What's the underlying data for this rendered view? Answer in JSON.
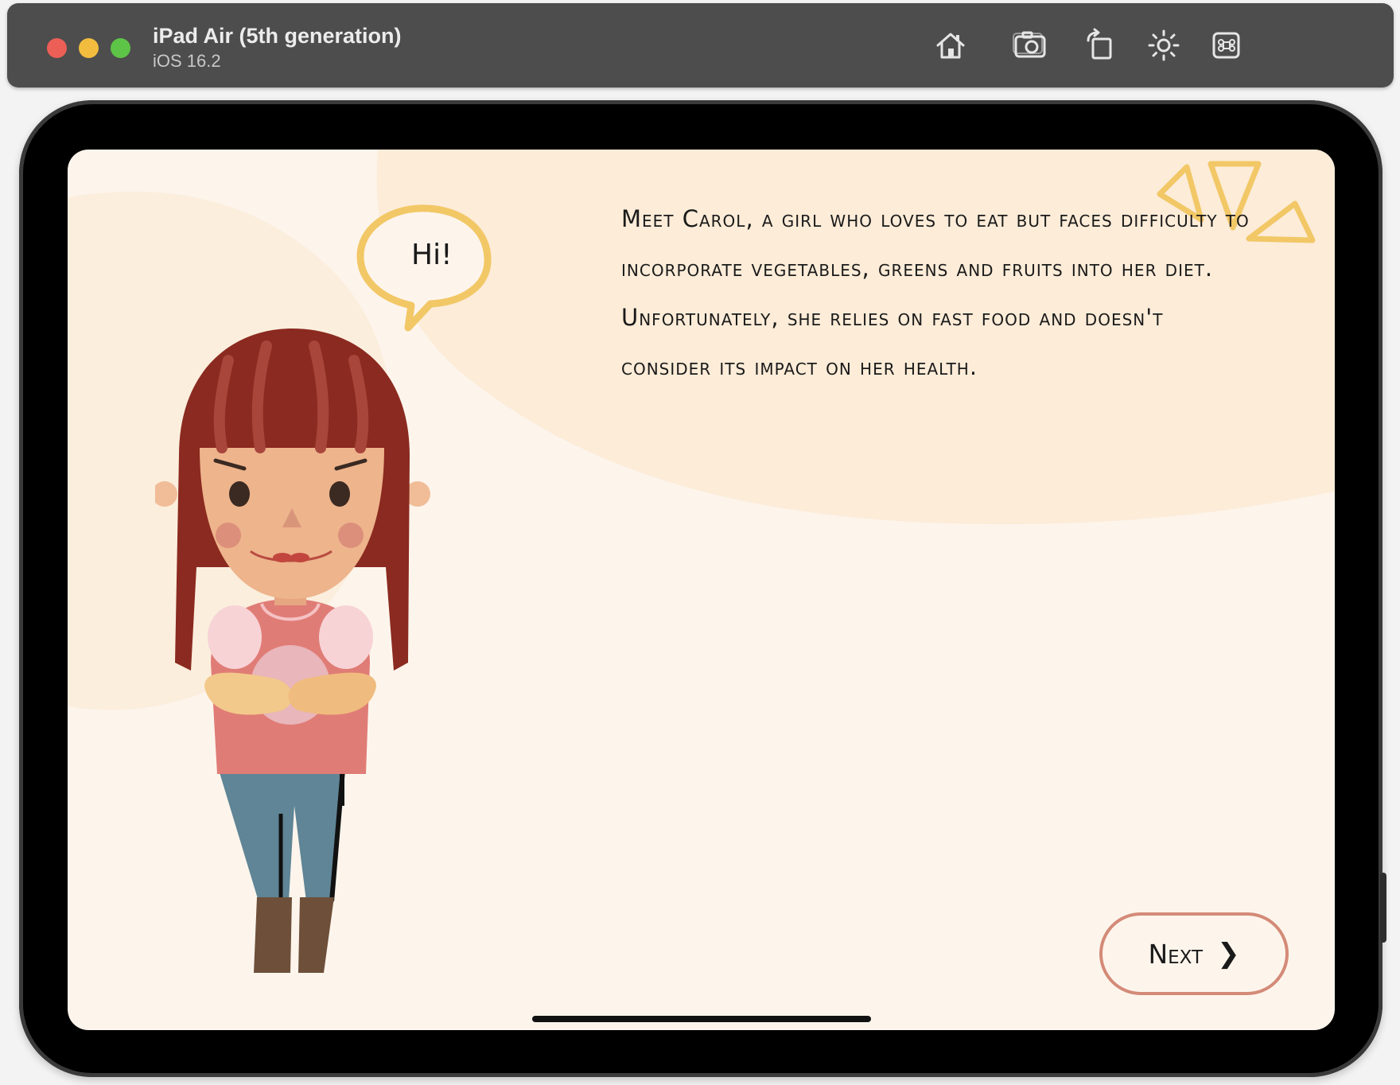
{
  "window": {
    "device_name": "iPad Air (5th generation)",
    "os_version": "iOS 16.2"
  },
  "toolbar": {
    "icons": [
      "home-icon",
      "screenshot-icon",
      "rotate-icon",
      "appearance-icon",
      "command-icon"
    ]
  },
  "story": {
    "text": "Meet Carol, a girl who loves to eat but faces difficulty to incorporate vegetables, greens and fruits into her diet. Unfortunately, she relies on fast food and doesn't consider its impact on her health.",
    "speech_bubble": "Hi!",
    "next_label": "Next",
    "next_chevron": "❯"
  },
  "colors": {
    "background": "#fdf5ec",
    "blob": "#fcecd8",
    "accent_yellow": "#f2c766",
    "button_border": "#d48a78",
    "hair": "#8b2a20"
  }
}
